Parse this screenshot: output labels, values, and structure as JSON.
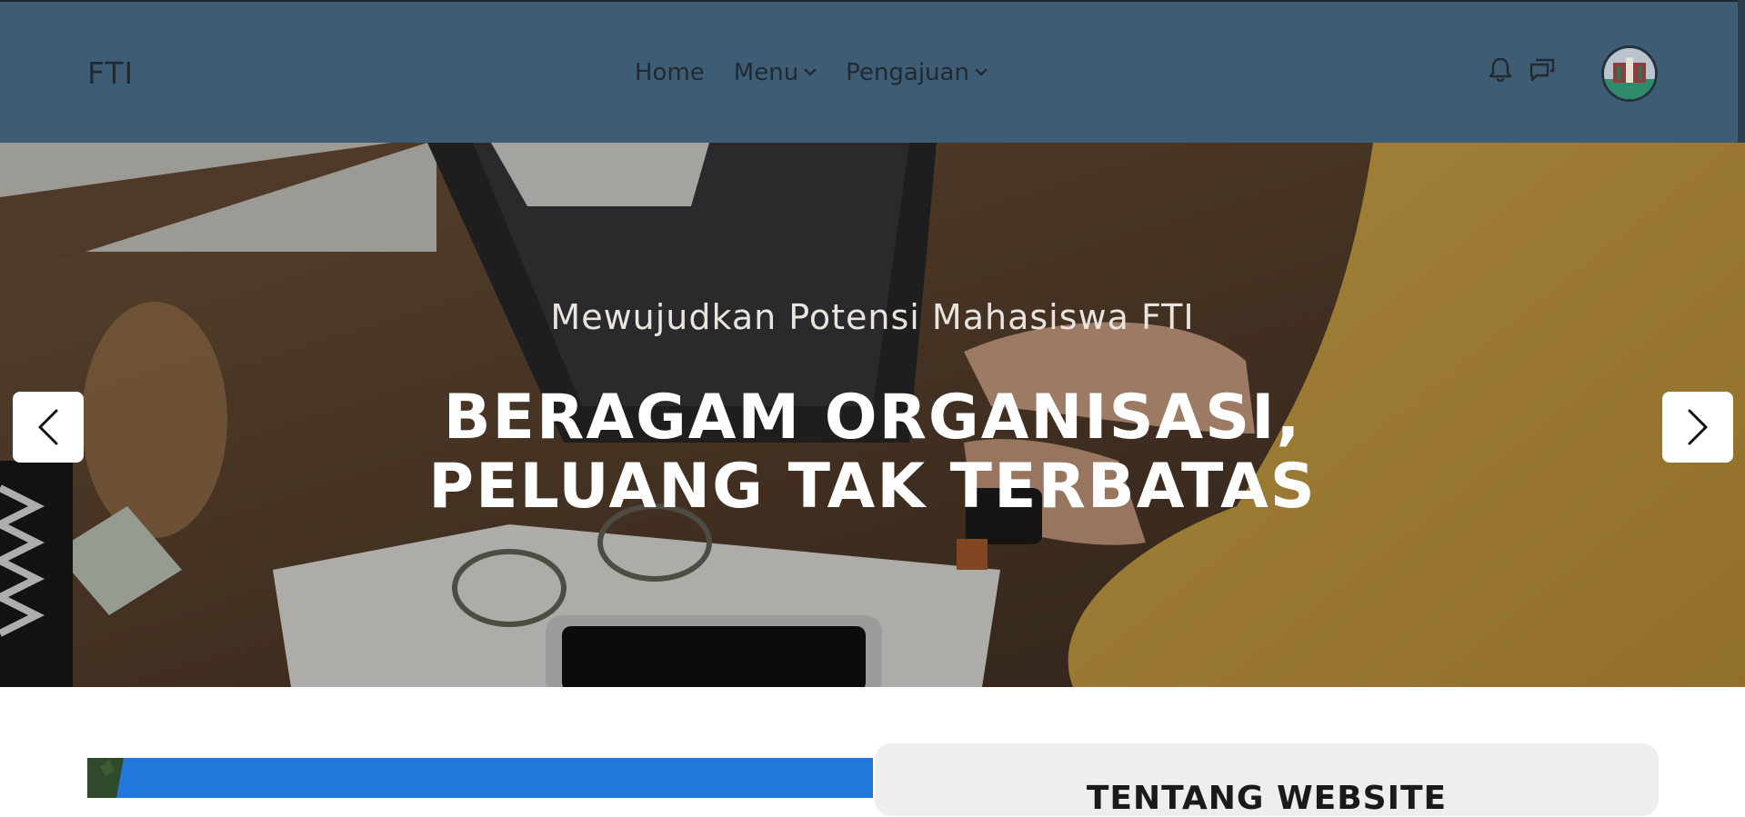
{
  "navbar": {
    "brand": "FTI",
    "items": [
      {
        "label": "Home",
        "has_dropdown": false
      },
      {
        "label": "Menu",
        "has_dropdown": true
      },
      {
        "label": "Pengajuan",
        "has_dropdown": true
      }
    ],
    "icons": [
      "bell-icon",
      "chat-icon"
    ],
    "background_color": "#3e5c73"
  },
  "hero": {
    "subtitle": "Mewujudkan Potensi Mahasiswa FTI",
    "title_line1": "BERAGAM ORGANISASI,",
    "title_line2": "PELUANG TAK TERBATAS"
  },
  "about": {
    "title": "TENTANG WEBSITE"
  }
}
